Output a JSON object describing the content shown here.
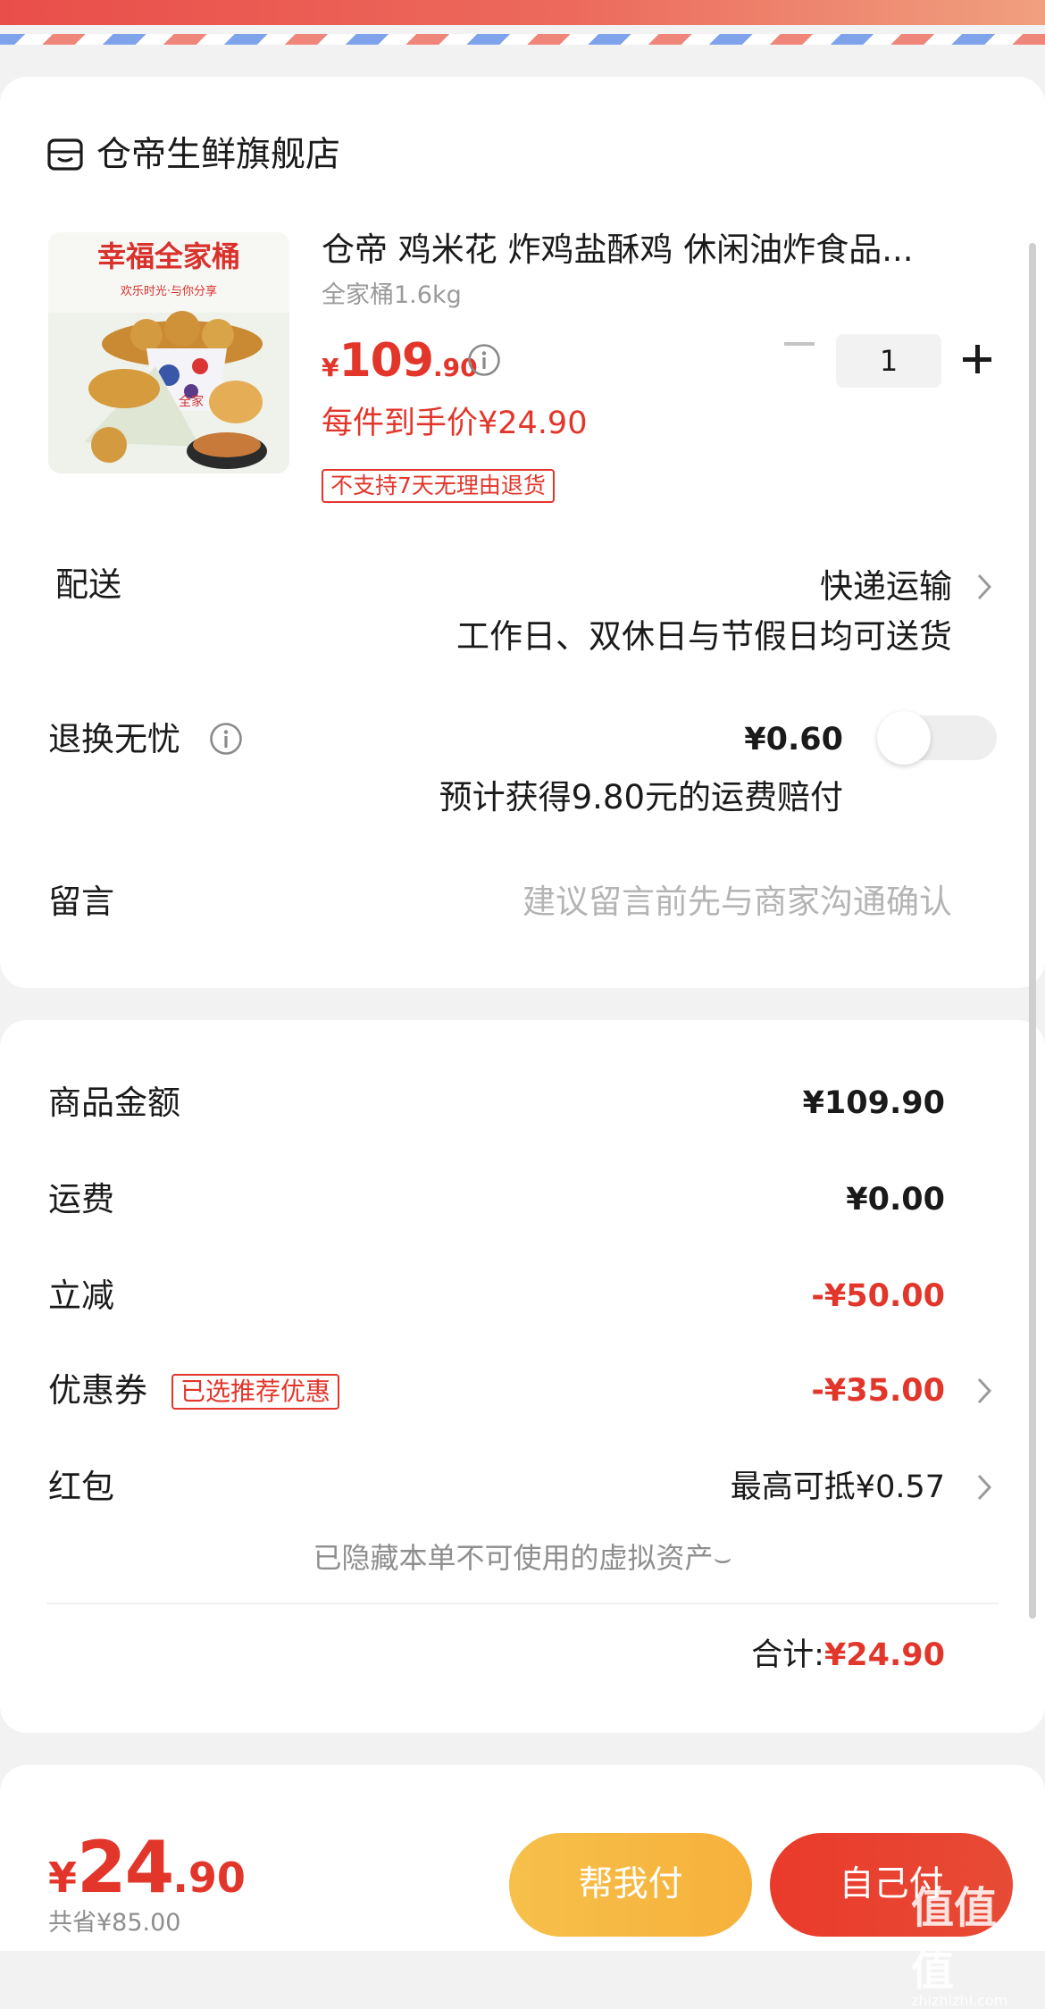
{
  "store": {
    "name": "仓帝生鲜旗舰店"
  },
  "product": {
    "image_text": {
      "headline": "幸福全家桶",
      "tagline": "欢乐时光·与你分享",
      "bucket_label": "全家"
    },
    "title": "仓帝 鸡米花 炸鸡盐酥鸡 休闲油炸食品...",
    "spec": "全家桶1.6kg",
    "price": {
      "symbol": "¥",
      "integer": "109",
      "decimal": ".90"
    },
    "deal_price": "每件到手价¥24.90",
    "return_tag": "不支持7天无理由退货",
    "quantity": "1"
  },
  "delivery": {
    "label": "配送",
    "method": "快递运输",
    "note": "工作日、双休日与节假日均可送货"
  },
  "return_insurance": {
    "label": "退换无忧",
    "price": "¥0.60",
    "note": "预计获得9.80元的运费赔付",
    "enabled": false
  },
  "message": {
    "label": "留言",
    "placeholder": "建议留言前先与商家沟通确认"
  },
  "summary": {
    "goods_label": "商品金额",
    "goods_value": "¥109.90",
    "shipping_label": "运费",
    "shipping_value": "¥0.00",
    "discount_label": "立减",
    "discount_value": "-¥50.00",
    "coupon_label": "优惠券",
    "coupon_tag": "已选推荐优惠",
    "coupon_value": "-¥35.00",
    "redpacket_label": "红包",
    "redpacket_value": "最高可抵¥0.57",
    "hidden_note": "已隐藏本单不可使用的虚拟资产⌣",
    "total_label": "合计:",
    "total_value": "¥24.90"
  },
  "footer": {
    "total": {
      "symbol": "¥",
      "integer": "24",
      "decimal": ".90"
    },
    "saved": "共省¥85.00",
    "help_pay": "帮我付",
    "self_pay": "自己付"
  },
  "watermark": {
    "main": "值值值",
    "sub": "zhizhizhi.com"
  },
  "colors": {
    "accent_red": "#e2362b",
    "help_button": "#f6b93f",
    "self_button": "#e8412f"
  }
}
